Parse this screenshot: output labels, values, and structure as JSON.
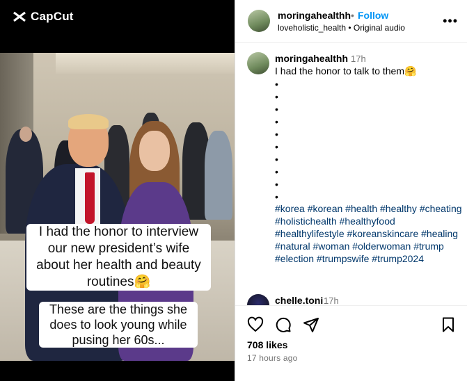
{
  "media": {
    "watermark": "CapCut",
    "overlay_line1": "I had the honor to interview our new president’s wife about her health and beauty routines🤗",
    "overlay_line2": "These are the things she does to look young while pusing her 60s..."
  },
  "header": {
    "username": "moringahealthh",
    "separator": "•",
    "follow_label": "Follow",
    "subtitle": "loveholistic_health • Original audio",
    "more_label": "•••"
  },
  "caption": {
    "username": "moringahealthh",
    "time": "17h",
    "text": "I had the honor to talk to them🤗",
    "bullets": "•\n•\n•\n•\n•\n•\n•\n•\n•\n•",
    "hashtags": "#korea #korean #health #healthy #cheating #holistichealth #healthyfood #healthylifestyle #koreanskincare #healing #natural #woman #olderwoman #trump #election #trumpswife #trump2024"
  },
  "comment": {
    "username": "chelle.toni",
    "time": "17h"
  },
  "actions": {
    "likes": "708 likes",
    "time_ago": "17 hours ago"
  },
  "icons": {
    "like": "heart-icon",
    "comment": "comment-bubble-icon",
    "share": "paper-plane-icon",
    "save": "bookmark-icon",
    "more": "more-options-icon"
  },
  "colors": {
    "follow": "#0095f6",
    "hashtag": "#00376b",
    "muted": "#737373"
  }
}
